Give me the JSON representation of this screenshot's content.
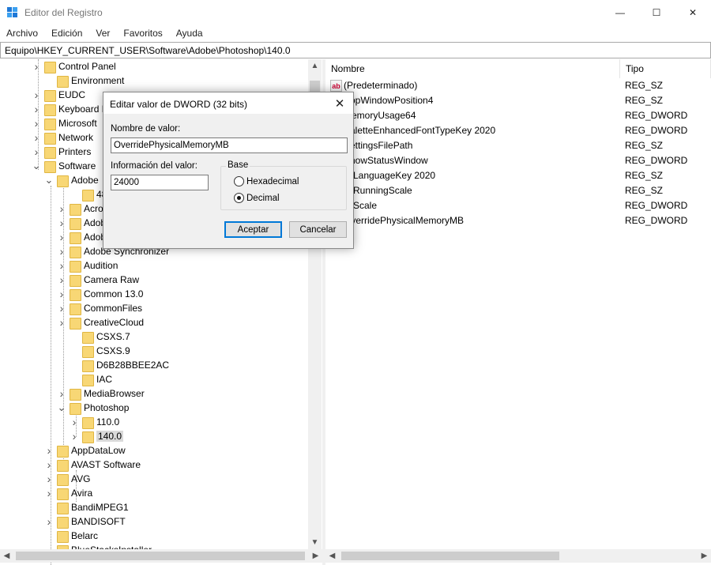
{
  "window": {
    "title": "Editor del Registro",
    "controls": {
      "minimize": "—",
      "maximize": "☐",
      "close": "✕"
    }
  },
  "menu": [
    "Archivo",
    "Edición",
    "Ver",
    "Favoritos",
    "Ayuda"
  ],
  "address": "Equipo\\HKEY_CURRENT_USER\\Software\\Adobe\\Photoshop\\140.0",
  "tree": [
    {
      "label": "Control Panel",
      "expander": "right"
    },
    {
      "label": "Environment",
      "expander": "none"
    },
    {
      "label": "EUDC",
      "expander": "right"
    },
    {
      "label": "Keyboard Layout",
      "expander": "right"
    },
    {
      "label": "Microsoft",
      "expander": "right"
    },
    {
      "label": "Network",
      "expander": "right"
    },
    {
      "label": "Printers",
      "expander": "right"
    },
    {
      "label": "Software",
      "expander": "down"
    },
    {
      "label": "Adobe",
      "expander": "down"
    },
    {
      "label": "4807",
      "expander": "none"
    },
    {
      "label": "Acrobat",
      "expander": "right"
    },
    {
      "label": "Adobe",
      "expander": "right"
    },
    {
      "label": "Adobe",
      "expander": "right"
    },
    {
      "label": "Adobe Synchronizer",
      "expander": "right"
    },
    {
      "label": "Audition",
      "expander": "right"
    },
    {
      "label": "Camera Raw",
      "expander": "right"
    },
    {
      "label": "Common 13.0",
      "expander": "right"
    },
    {
      "label": "CommonFiles",
      "expander": "right"
    },
    {
      "label": "CreativeCloud",
      "expander": "right"
    },
    {
      "label": "CSXS.7",
      "expander": "none"
    },
    {
      "label": "CSXS.9",
      "expander": "none"
    },
    {
      "label": "D6B28BBEE2AC",
      "expander": "none"
    },
    {
      "label": "IAC",
      "expander": "none"
    },
    {
      "label": "MediaBrowser",
      "expander": "right"
    },
    {
      "label": "Photoshop",
      "expander": "down"
    },
    {
      "label": "110.0",
      "expander": "right"
    },
    {
      "label": "140.0",
      "expander": "right",
      "selected": true
    },
    {
      "label": "AppDataLow",
      "expander": "right"
    },
    {
      "label": "AVAST Software",
      "expander": "right"
    },
    {
      "label": "AVG",
      "expander": "right"
    },
    {
      "label": "Avira",
      "expander": "right"
    },
    {
      "label": "BandiMPEG1",
      "expander": "none"
    },
    {
      "label": "BANDISOFT",
      "expander": "right"
    },
    {
      "label": "Belarc",
      "expander": "none"
    },
    {
      "label": "BlueStacksInstaller",
      "expander": "none"
    }
  ],
  "list": {
    "columns": {
      "name": "Nombre",
      "type": "Tipo"
    },
    "rows": [
      {
        "name": "(Predeterminado)",
        "type": "REG_SZ",
        "icon": "ab"
      },
      {
        "name": "AppWindowPosition4",
        "type": "REG_SZ",
        "icon": "ab"
      },
      {
        "name": "MemoryUsage64",
        "type": "REG_DWORD",
        "icon": "01"
      },
      {
        "name": "PaletteEnhancedFontTypeKey 2020",
        "type": "REG_DWORD",
        "icon": "01"
      },
      {
        "name": "SettingsFilePath",
        "type": "REG_SZ",
        "icon": "ab"
      },
      {
        "name": "ShowStatusWindow",
        "type": "REG_DWORD",
        "icon": "01"
      },
      {
        "name": "UILanguageKey 2020",
        "type": "REG_SZ",
        "icon": "ab"
      },
      {
        "name": "UIRunningScale",
        "type": "REG_SZ",
        "icon": "ab"
      },
      {
        "name": "UIScale",
        "type": "REG_DWORD",
        "icon": "01"
      },
      {
        "name": "OverridePhysicalMemoryMB",
        "type": "REG_DWORD",
        "icon": "01"
      }
    ]
  },
  "dialog": {
    "title": "Editar valor de DWORD (32 bits)",
    "close": "✕",
    "name_label": "Nombre de valor:",
    "name_value": "OverridePhysicalMemoryMB",
    "data_label": "Información del valor:",
    "data_value": "24000",
    "base_label": "Base",
    "hex_label": "Hexadecimal",
    "dec_label": "Decimal",
    "selected_base": "decimal",
    "ok": "Aceptar",
    "cancel": "Cancelar"
  },
  "scroll": {
    "up": "▲",
    "down": "▼",
    "left": "◀",
    "right": "▶"
  }
}
